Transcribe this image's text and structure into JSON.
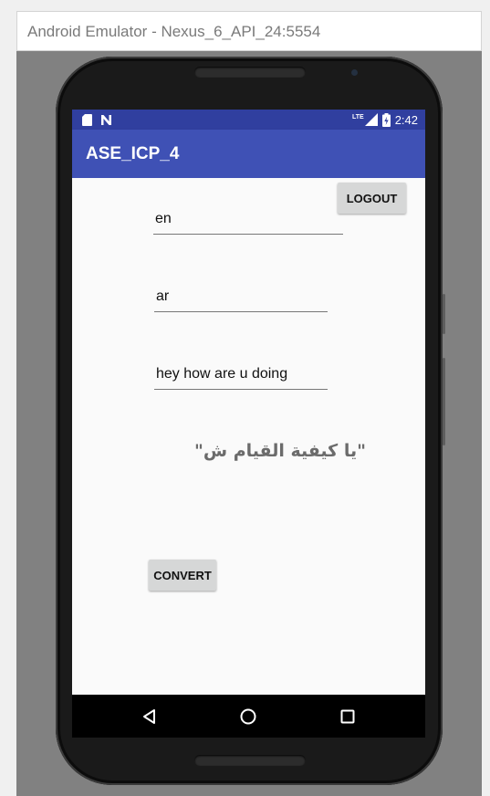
{
  "window": {
    "title": "Android Emulator - Nexus_6_API_24:5554"
  },
  "statusbar": {
    "time": "2:42",
    "network": "LTE",
    "icons": [
      "sim-card-icon",
      "notification-n-icon",
      "signal-icon",
      "battery-icon"
    ]
  },
  "app": {
    "title": "ASE_ICP_4"
  },
  "logout_button": {
    "label": "LOGOUT"
  },
  "fields": {
    "source_lang": {
      "value": "en"
    },
    "target_lang": {
      "value": "ar"
    },
    "input_text": {
      "value": "hey how are u doing"
    }
  },
  "result": {
    "text": "\"يا كيفية القيام ش\""
  },
  "convert_button": {
    "label": "CONVERT"
  },
  "navbar": {
    "icons": [
      "back-icon",
      "home-icon",
      "recents-icon"
    ]
  },
  "colors": {
    "primary": "#3f51b5",
    "primary_dark": "#303f9f",
    "button": "#d6d7d7",
    "background": "#fafafa"
  }
}
